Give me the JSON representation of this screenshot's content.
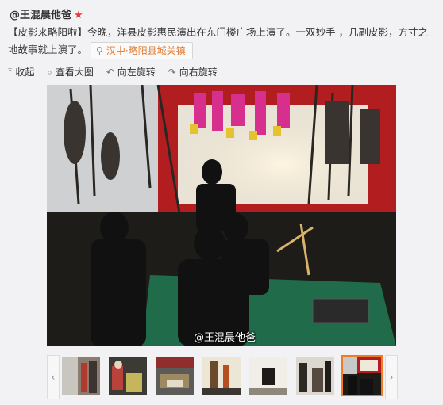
{
  "post": {
    "author": "@王混晨他爸",
    "star": "★",
    "text": "【皮影来略阳啦】今晚，洋县皮影惠民演出在东门楼广场上演了。一双妙手 ，几副皮影，方寸之地故事就上演了。",
    "location": "汉中·略阳县城关镇",
    "location_icon": "location-pin-icon"
  },
  "toolbar": {
    "collapse_label": "收起",
    "view_large_label": "查看大图",
    "rotate_left_label": "向左旋转",
    "rotate_right_label": "向右旋转",
    "icons": [
      "arrow-up-icon",
      "search-icon",
      "rotate-left-icon",
      "rotate-right-icon"
    ]
  },
  "photo": {
    "watermark": "@王混晨他爸"
  },
  "thumbnails": {
    "count": 7,
    "selected_index": 6,
    "selected_border_color": "#f07b24",
    "prev_glyph": "‹",
    "next_glyph": "›"
  }
}
